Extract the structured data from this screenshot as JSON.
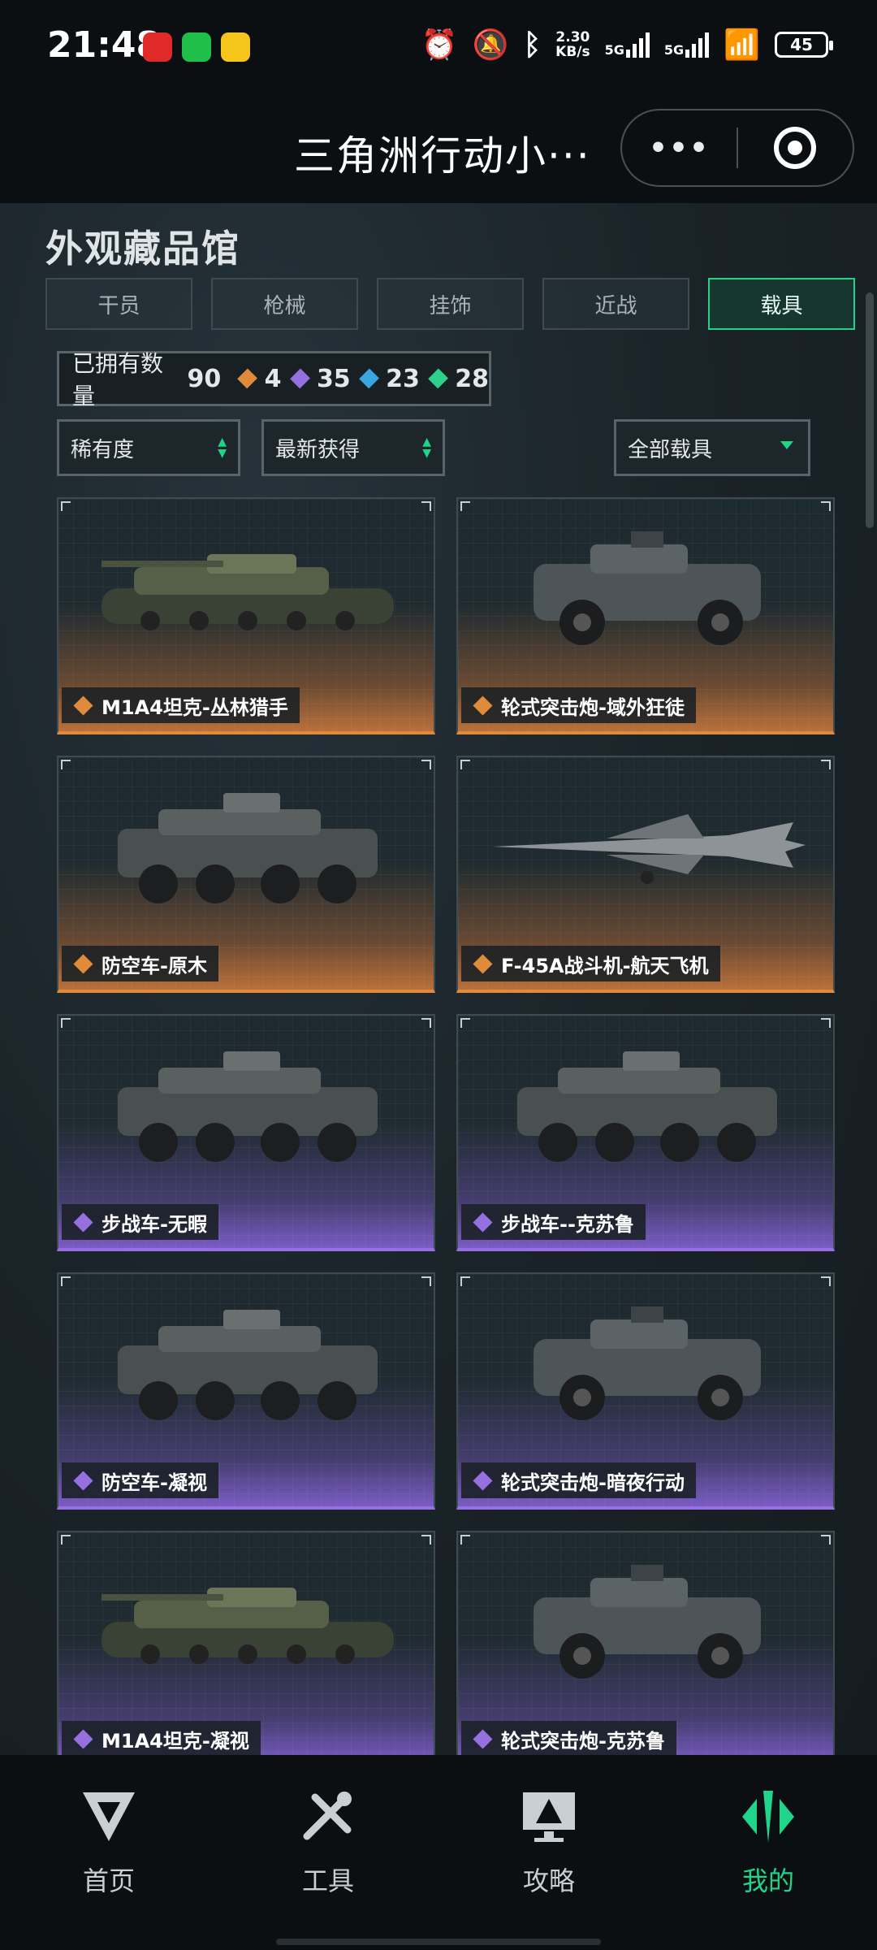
{
  "status_bar": {
    "time": "21:48",
    "net_speed_value": "2.30",
    "net_speed_unit": "KB/s",
    "signal1": "5G",
    "signal2": "5G",
    "battery": "45"
  },
  "title_bar": {
    "title": "三角洲行动小···",
    "more_label": "•••"
  },
  "page": {
    "title": "外观藏品馆",
    "tabs": [
      {
        "label": "干员",
        "active": false
      },
      {
        "label": "枪械",
        "active": false
      },
      {
        "label": "挂饰",
        "active": false
      },
      {
        "label": "近战",
        "active": false
      },
      {
        "label": "载具",
        "active": true
      }
    ],
    "owned": {
      "label": "已拥有数量",
      "total": "90",
      "gold": "4",
      "purple": "35",
      "blue": "23",
      "green": "28"
    },
    "filters": {
      "rarity": "稀有度",
      "sort": "最新获得",
      "category": "全部载具"
    },
    "items": [
      {
        "name": "M1A4坦克-丛林猎手",
        "rarity": "gold",
        "icon": "tank"
      },
      {
        "name": "轮式突击炮-域外狂徒",
        "rarity": "gold",
        "icon": "armored-car"
      },
      {
        "name": "防空车-原木",
        "rarity": "gold",
        "icon": "apc"
      },
      {
        "name": "F-45A战斗机-航天飞机",
        "rarity": "gold",
        "icon": "jet"
      },
      {
        "name": "步战车-无暇",
        "rarity": "purple",
        "icon": "apc"
      },
      {
        "name": "步战车--克苏鲁",
        "rarity": "purple",
        "icon": "apc"
      },
      {
        "name": "防空车-凝视",
        "rarity": "purple",
        "icon": "apc"
      },
      {
        "name": "轮式突击炮-暗夜行动",
        "rarity": "purple",
        "icon": "armored-car"
      },
      {
        "name": "M1A4坦克-凝视",
        "rarity": "purple",
        "icon": "tank"
      },
      {
        "name": "轮式突击炮-克苏鲁",
        "rarity": "purple",
        "icon": "armored-car"
      }
    ]
  },
  "nav": [
    {
      "label": "首页",
      "icon": "delta-logo-icon",
      "active": false
    },
    {
      "label": "工具",
      "icon": "tools-icon",
      "active": false
    },
    {
      "label": "攻略",
      "icon": "guide-monitor-icon",
      "active": false
    },
    {
      "label": "我的",
      "icon": "profile-logo-icon",
      "active": true
    }
  ],
  "colors": {
    "accent": "#1fd486",
    "gold": "#e08a3c",
    "purple": "#9670e0",
    "blue": "#3aa6e0",
    "green": "#2fd08a"
  }
}
